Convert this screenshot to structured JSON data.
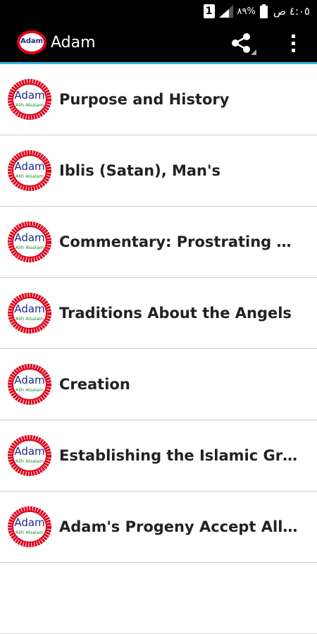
{
  "status_bar": {
    "sim_label": "1",
    "battery_text": "٨٩%",
    "time_text": "٤:٠٥ ص"
  },
  "action_bar": {
    "title": "Adam",
    "logo_text": "Adam",
    "icons": [
      "share-icon",
      "overflow-menu-icon"
    ]
  },
  "logo": {
    "main_text": "Adam",
    "sub_text": "Alih Alsalam",
    "border_color": "#e0001a",
    "main_color": "#1a2a8a",
    "sub_color": "#1a8a2a"
  },
  "list": {
    "items": [
      {
        "title": "Purpose and History"
      },
      {
        "title": "Iblis (Satan), Man's"
      },
      {
        "title": "Commentary: Prostrating Before Adam"
      },
      {
        "title": "Traditions About the Angels"
      },
      {
        "title": "Creation"
      },
      {
        "title": "Establishing the Islamic Greeting"
      },
      {
        "title": "Adam's Progeny Accept Allah"
      },
      {
        "title": ""
      }
    ]
  },
  "colors": {
    "action_bar_bg": "#000000",
    "action_bar_accent": "#33b5e5",
    "list_bg": "#ffffff",
    "divider": "#cfcfcf"
  }
}
